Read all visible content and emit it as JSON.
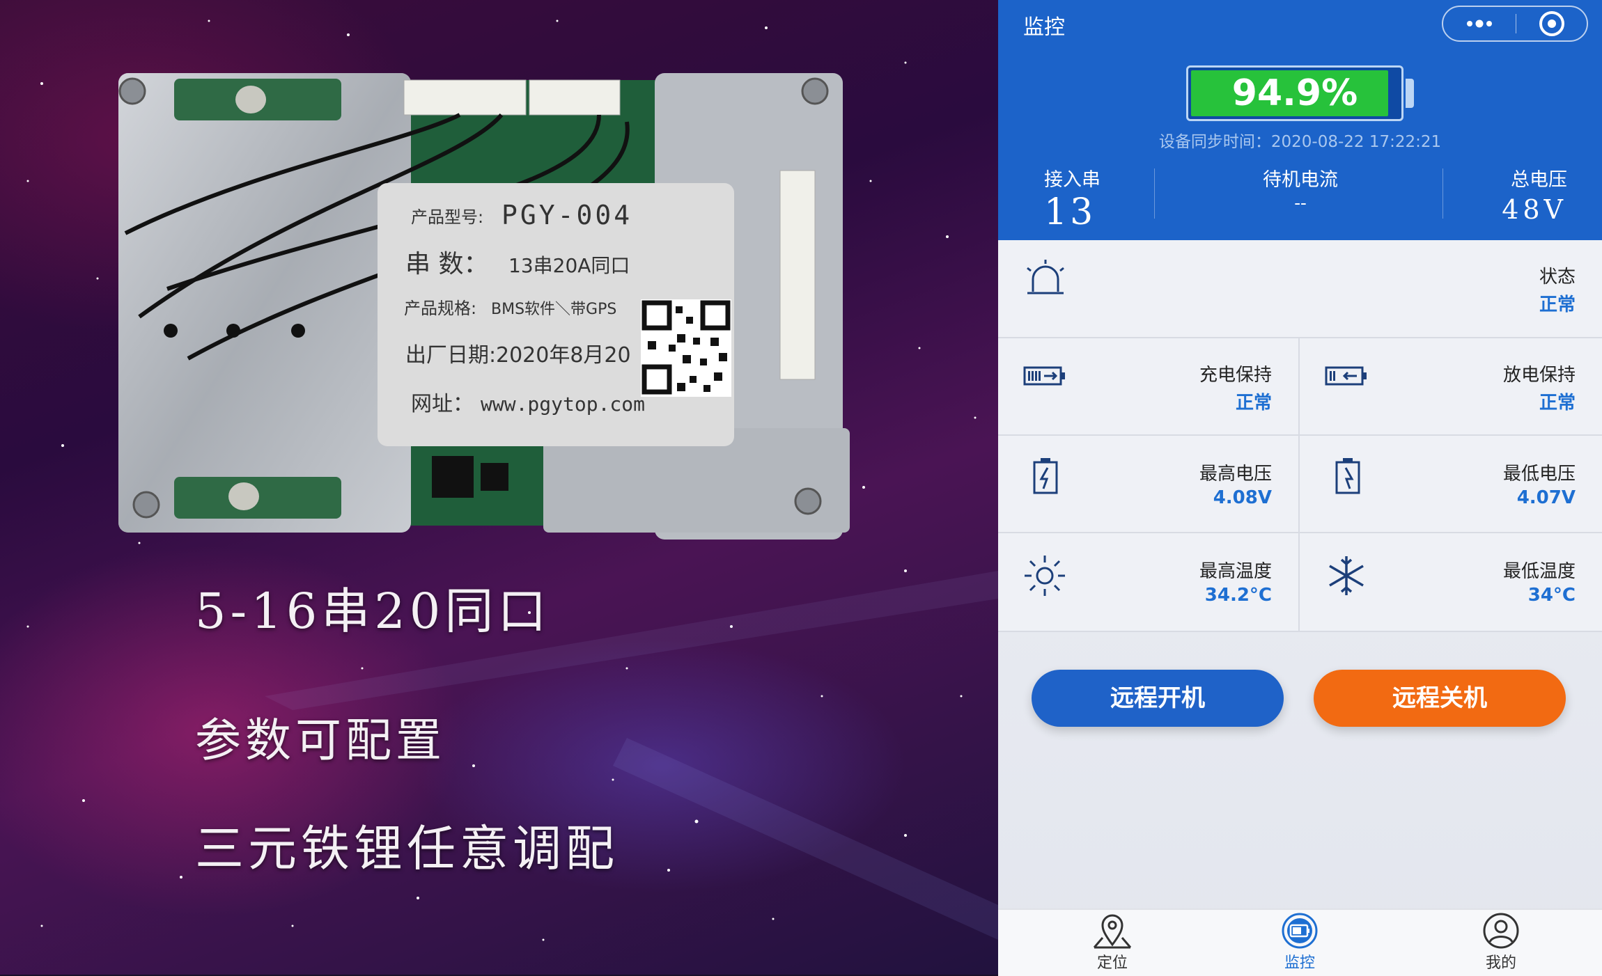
{
  "promo": {
    "line1": "5-16串20同口",
    "line2": "参数可配置",
    "line3": "三元铁锂任意调配",
    "label": {
      "model_label": "产品型号:",
      "model": "PGY-004",
      "series_label": "串 数：",
      "series": "13串20A同口",
      "spec_label": "产品规格:",
      "spec": "BMS软件＼带GPS",
      "date_label": "出厂日期:",
      "date": "2020年8月20",
      "site_label": "网址：",
      "site": "www.pgytop.com"
    }
  },
  "app": {
    "title": "监控",
    "battery_percent": "94.9%",
    "battery_level": 0.949,
    "sync_time": "设备同步时间：2020-08-22 17:22:21",
    "stats": {
      "series_label": "接入串",
      "series_value": "13",
      "current_label": "待机电流",
      "current_value": "--",
      "voltage_label": "总电压",
      "voltage_value": "48V"
    },
    "status": {
      "label": "状态",
      "value": "正常"
    },
    "charge_protect": {
      "label": "充电保持",
      "value": "正常"
    },
    "discharge_protect": {
      "label": "放电保持",
      "value": "正常"
    },
    "max_voltage": {
      "label": "最高电压",
      "value": "4.08V"
    },
    "min_voltage": {
      "label": "最低电压",
      "value": "4.07V"
    },
    "max_temp": {
      "label": "最高温度",
      "value": "34.2°C"
    },
    "min_temp": {
      "label": "最低温度",
      "value": "34°C"
    },
    "buttons": {
      "power_on": "远程开机",
      "power_off": "远程关机"
    },
    "tabs": {
      "location": "定位",
      "monitor": "监控",
      "mine": "我的"
    },
    "colors": {
      "header": "#1c63c9",
      "accent_value": "#1e6fd2",
      "power_on": "#1f62c8",
      "power_off": "#f26a12",
      "battery_fill": "#27c23b"
    }
  }
}
